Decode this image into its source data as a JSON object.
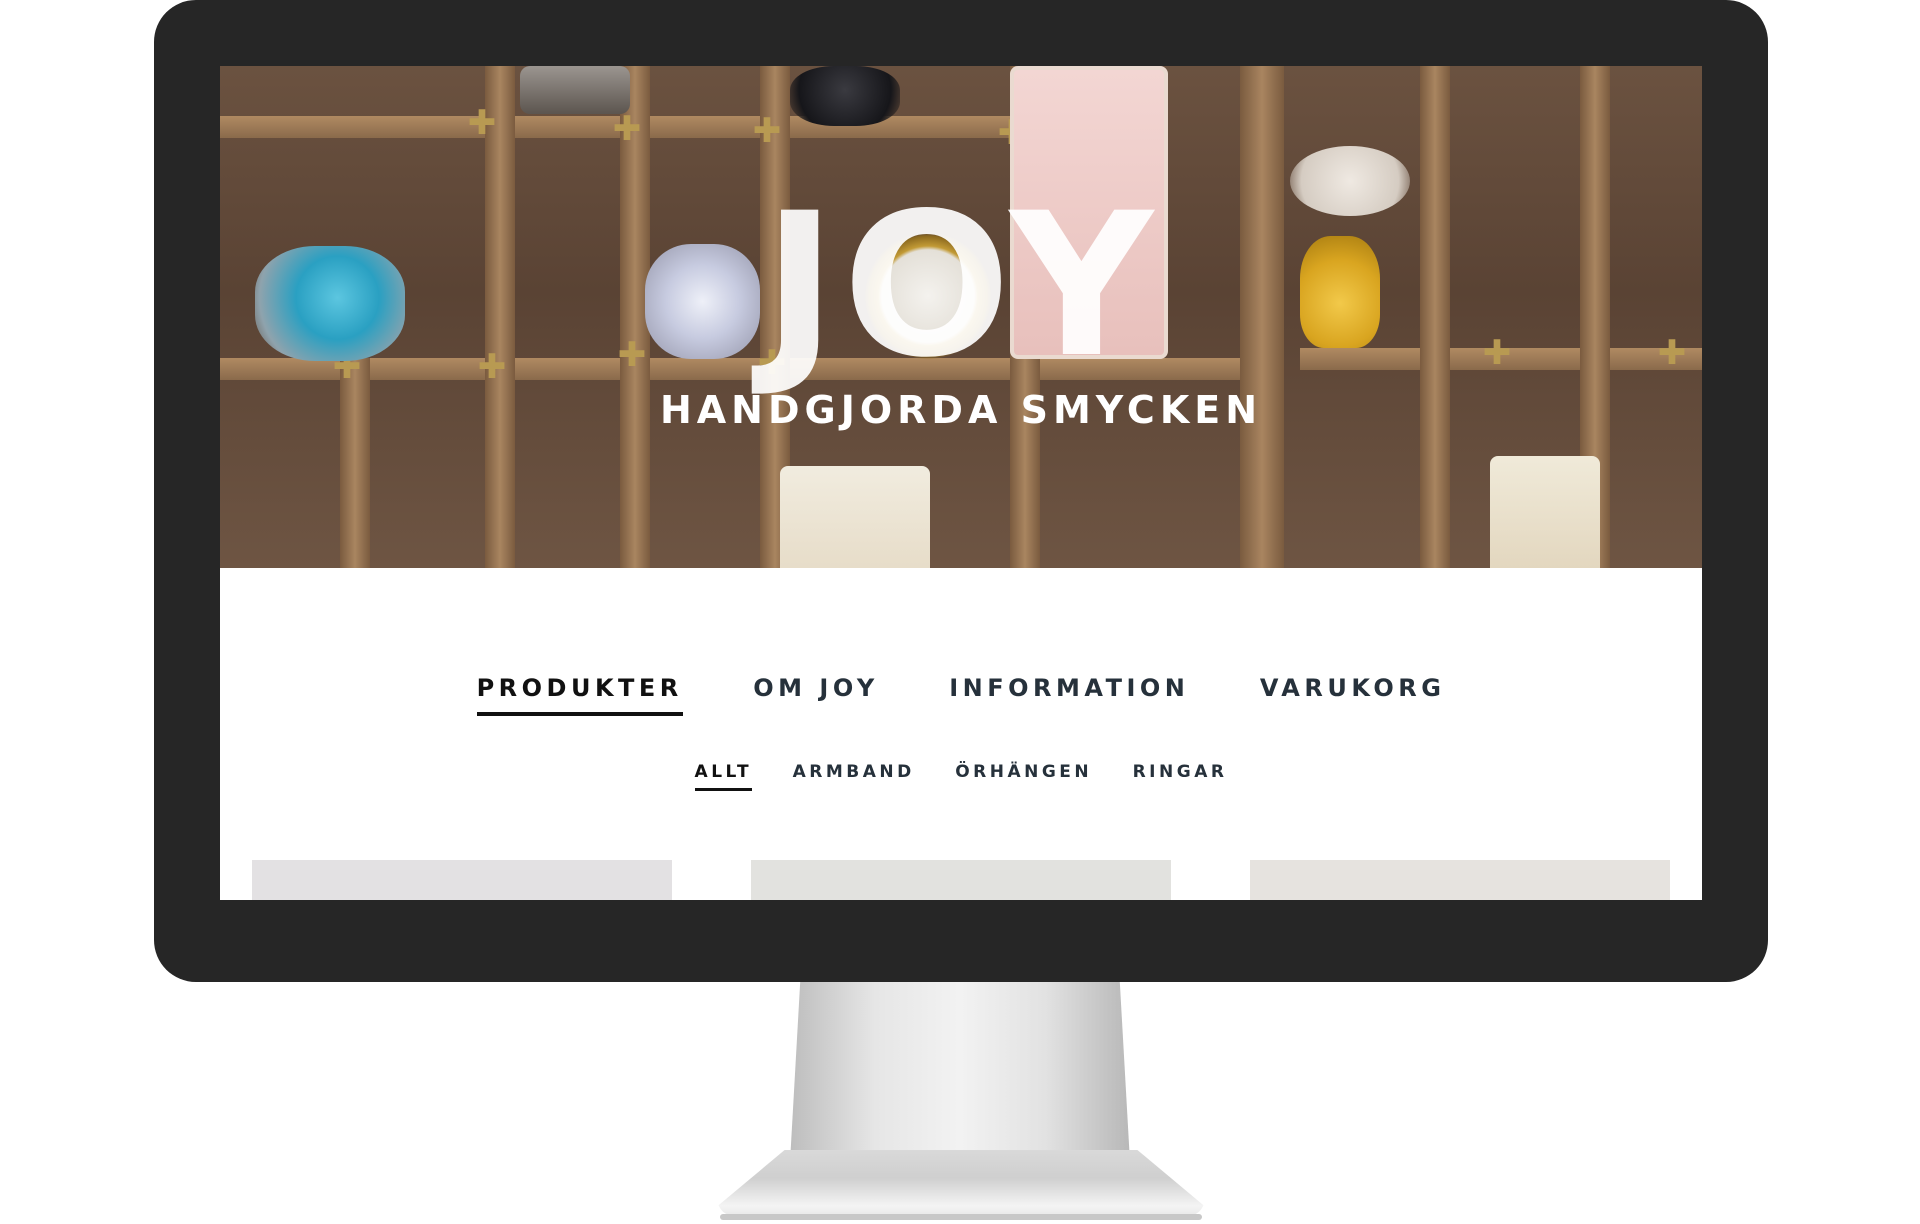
{
  "hero": {
    "title": "JOY",
    "subtitle": "HANDGJORDA SMYCKEN"
  },
  "main_nav": {
    "items": [
      {
        "label": "PRODUKTER",
        "active": true
      },
      {
        "label": "OM JOY",
        "active": false
      },
      {
        "label": "INFORMATION",
        "active": false
      },
      {
        "label": "VARUKORG",
        "active": false
      }
    ]
  },
  "sub_nav": {
    "items": [
      {
        "label": "ALLT",
        "active": true
      },
      {
        "label": "ARMBAND",
        "active": false
      },
      {
        "label": "ÖRHÄNGEN",
        "active": false
      },
      {
        "label": "RINGAR",
        "active": false
      }
    ]
  },
  "colors": {
    "bezel": "#262626",
    "nav_text": "#26313b",
    "active_underline": "#111111"
  }
}
